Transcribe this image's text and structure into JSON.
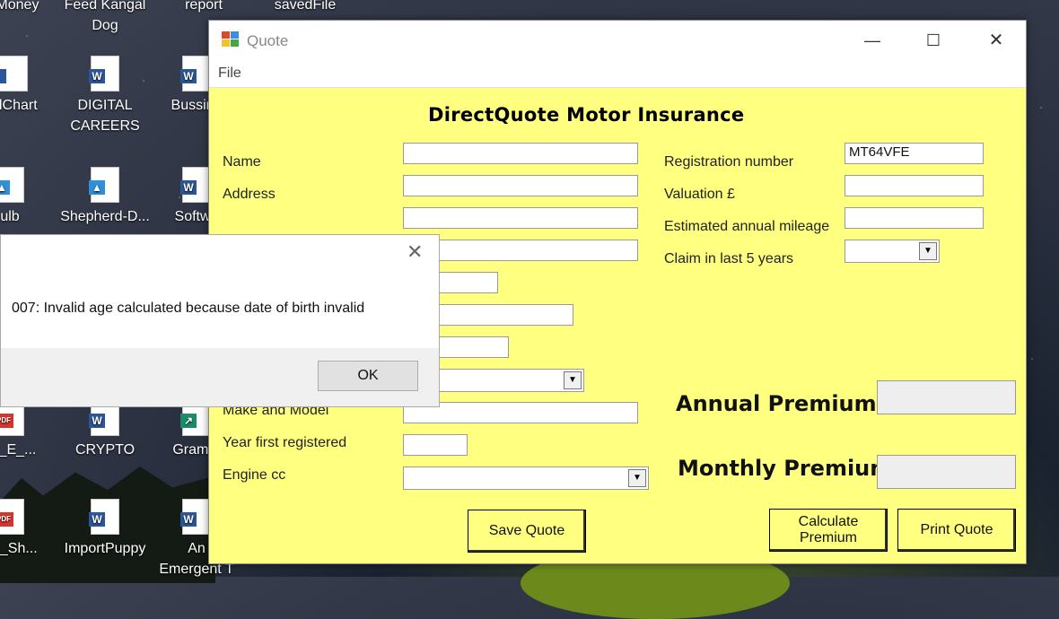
{
  "desktop": {
    "icons": [
      {
        "label": "gMoney",
        "x": 0
      },
      {
        "label": "Feed Kangal Dog"
      },
      {
        "label": "report"
      },
      {
        "label": "savedFile"
      },
      {
        "label": "rdChart"
      },
      {
        "label": "DIGITAL CAREERS"
      },
      {
        "label": "Bussine"
      },
      {
        "label": "ulb"
      },
      {
        "label": "Shepherd-D..."
      },
      {
        "label": "Softwa"
      },
      {
        "label": "ce_E_..."
      },
      {
        "label": "CRYPTO"
      },
      {
        "label": "Gramm"
      },
      {
        "label": "_E_Sh..."
      },
      {
        "label": "ImportPuppy"
      },
      {
        "label": "An"
      },
      {
        "label": "Emergent T"
      }
    ]
  },
  "window": {
    "title": "Quote",
    "menu": {
      "file": "File"
    },
    "controls": {
      "minimize": "—",
      "maximize": "☐",
      "close": "✕"
    }
  },
  "form": {
    "heading": "DirectQuote Motor Insurance",
    "labels": {
      "name": "Name",
      "address": "Address",
      "registration": "Registration number",
      "valuation": "Valuation £",
      "mileage": "Estimated annual mileage",
      "claim": "Claim in last 5 years",
      "make_model": "Make and Model",
      "year_registered": "Year first registered",
      "engine": "Engine cc"
    },
    "values": {
      "registration": "MT64VFE",
      "name": "",
      "valuation": "",
      "mileage": ""
    },
    "annual_premium_label": "Annual Premium",
    "monthly_premium_label": "Monthly Premium",
    "buttons": {
      "save": "Save Quote",
      "calculate_line1": "Calculate",
      "calculate_line2": "Premium",
      "print": "Print Quote"
    }
  },
  "dialog": {
    "message": "007: Invalid age calculated because date of birth invalid",
    "ok": "OK",
    "close": "✕"
  }
}
